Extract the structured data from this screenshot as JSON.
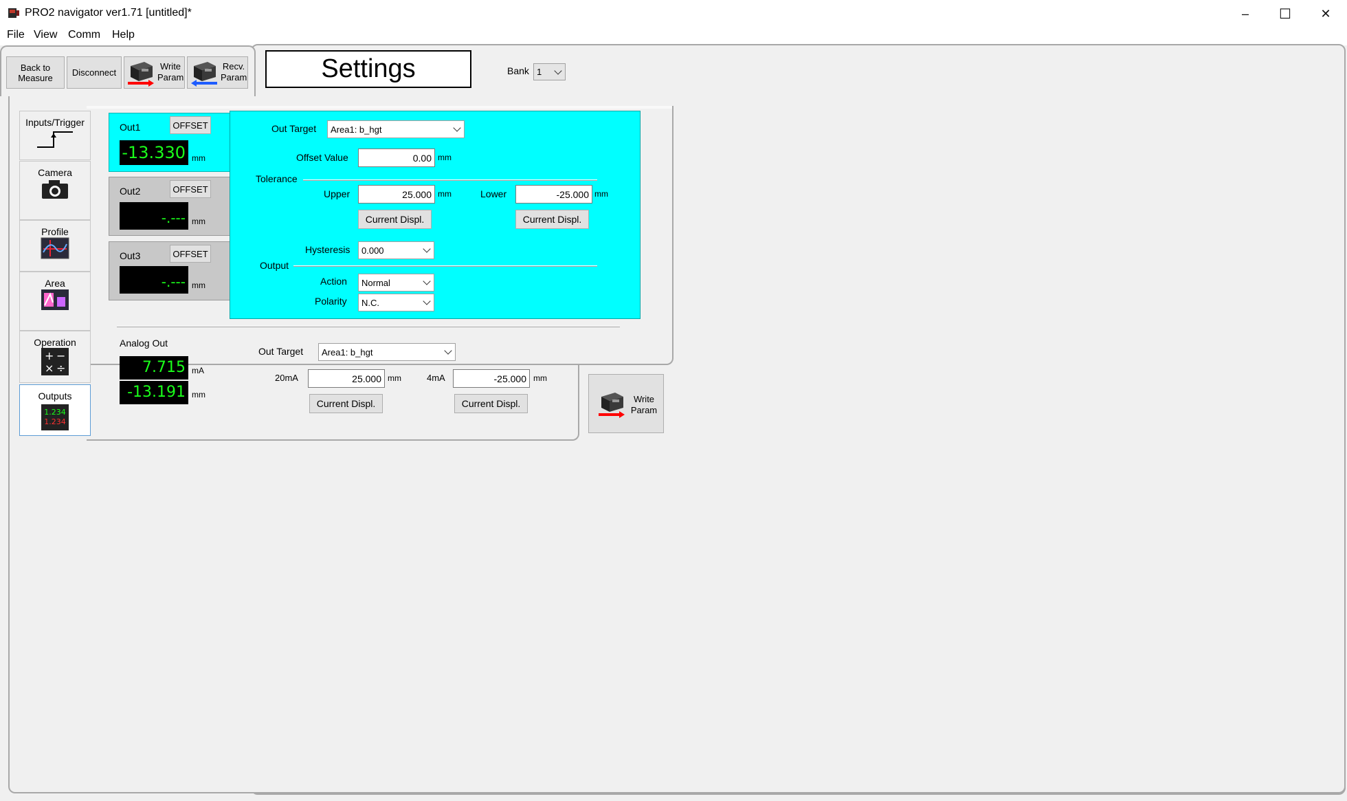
{
  "window": {
    "title": "PRO2 navigator ver1.71 [untitled]*",
    "minimize": "–",
    "maximize": "☐",
    "close": "✕"
  },
  "menu": [
    "File",
    "View",
    "Comm",
    "Help"
  ],
  "toolbar": {
    "back_line1": "Back to",
    "back_line2": "Measure",
    "disconnect": "Disconnect",
    "write_line1": "Write",
    "write_line2": "Param",
    "recv_line1": "Recv.",
    "recv_line2": "Param"
  },
  "header": {
    "title": "Settings",
    "bank_label": "Bank",
    "bank_value": "1"
  },
  "sidebar": {
    "items": [
      {
        "label": "Inputs/Trigger",
        "icon": "trigger-icon"
      },
      {
        "label": "Camera",
        "icon": "camera-icon"
      },
      {
        "label": "Profile",
        "icon": "profile-icon"
      },
      {
        "label": "Area",
        "icon": "area-icon"
      },
      {
        "label": "Operation",
        "icon": "operation-icon"
      },
      {
        "label": "Outputs",
        "icon": "outputs-icon",
        "selected": true
      }
    ],
    "outputs_icon_text": "1.234"
  },
  "outputs": [
    {
      "label": "Out1",
      "offset": "OFFSET",
      "value": "-13.330",
      "unit": "mm",
      "active": true
    },
    {
      "label": "Out2",
      "offset": "OFFSET",
      "value": "-.---",
      "unit": "mm",
      "active": false
    },
    {
      "label": "Out3",
      "offset": "OFFSET",
      "value": "-.---",
      "unit": "mm",
      "active": false
    }
  ],
  "detail": {
    "out_target_label": "Out Target",
    "out_target_value": "Area1: b_hgt",
    "offset_label": "Offset Value",
    "offset_value": "0.00",
    "offset_unit": "mm",
    "tolerance_label": "Tolerance",
    "upper_label": "Upper",
    "upper_value": "25.000",
    "upper_unit": "mm",
    "lower_label": "Lower",
    "lower_value": "-25.000",
    "lower_unit": "mm",
    "current_displ": "Current Displ.",
    "hysteresis_label": "Hysteresis",
    "hysteresis_value": "0.000",
    "output_label": "Output",
    "action_label": "Action",
    "action_value": "Normal",
    "polarity_label": "Polarity",
    "polarity_value": "N.C."
  },
  "analog": {
    "label": "Analog Out",
    "value_ma": "7.715",
    "unit_ma": "mA",
    "value_mm": "-13.191",
    "unit_mm": "mm",
    "out_target_label": "Out Target",
    "out_target_value": "Area1: b_hgt",
    "ma20_label": "20mA",
    "ma20_value": "25.000",
    "ma20_unit": "mm",
    "ma4_label": "4mA",
    "ma4_value": "-25.000",
    "ma4_unit": "mm",
    "current_displ": "Current Displ."
  },
  "write_param_bottom": {
    "line1": "Write",
    "line2": "Param"
  },
  "colors": {
    "active_panel": "#00ffff",
    "lcd_bg": "#000000",
    "lcd_fg": "#1aff1a",
    "accent_red": "#ff0000",
    "accent_blue": "#1e5cff"
  }
}
